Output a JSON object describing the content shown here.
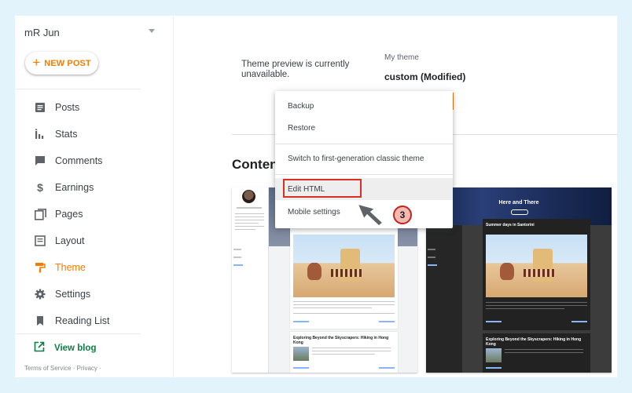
{
  "sidebar": {
    "blog_name": "mR Jun",
    "new_post_label": "NEW POST",
    "items": [
      {
        "label": "Posts",
        "icon": "posts-icon"
      },
      {
        "label": "Stats",
        "icon": "stats-icon"
      },
      {
        "label": "Comments",
        "icon": "comments-icon"
      },
      {
        "label": "Earnings",
        "icon": "dollar-icon"
      },
      {
        "label": "Pages",
        "icon": "pages-icon"
      },
      {
        "label": "Layout",
        "icon": "layout-icon"
      },
      {
        "label": "Theme",
        "icon": "paint-roller-icon",
        "active": true
      },
      {
        "label": "Settings",
        "icon": "gear-icon"
      },
      {
        "label": "Reading List",
        "icon": "bookmark-icon"
      }
    ],
    "view_blog_label": "View blog",
    "footer_links": "Terms of Service · Privacy ·"
  },
  "main": {
    "preview_message": "Theme preview is currently unavailable.",
    "my_theme_label": "My theme",
    "my_theme_name": "custom (Modified)",
    "section_title": "Conten"
  },
  "menu": {
    "items": [
      "Backup",
      "Restore",
      "Switch to first-generation classic theme",
      "Edit HTML",
      "Mobile settings"
    ],
    "highlighted": "Edit HTML"
  },
  "thumbnails": {
    "light": {
      "post_title": "Exploring Beyond the Skyscrapers: Hiking in Hong Kong"
    },
    "dark": {
      "blog_title": "Here and There",
      "post_title_1": "Summer days in Santorini",
      "post_title_2": "Exploring Beyond the Skyscrapers: Hiking in Hong Kong"
    }
  },
  "annotation": {
    "step_number": "3"
  },
  "colors": {
    "accent": "#f57c00",
    "view_blog": "#0b8043",
    "highlight_box": "#d93025",
    "page_background": "#e3f3fb"
  }
}
